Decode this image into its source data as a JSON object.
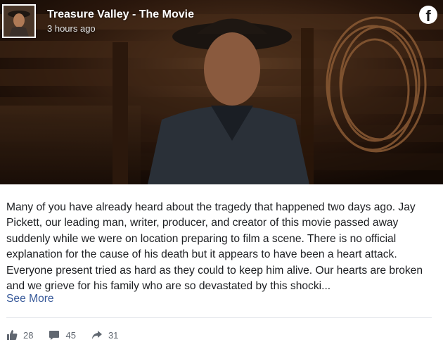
{
  "post": {
    "page_name": "Treasure Valley - The Movie",
    "time": "3 hours ago",
    "brand_icon": "facebook-icon",
    "body": "Many of you have already heard about the tragedy that happened two days ago. Jay Pickett, our leading man, writer, producer, and creator of this movie passed away suddenly while we were on location preparing to film a scene. There is no official explanation for the cause of his death but it appears to have been a heart attack. Everyone present tried as hard as they could to keep him alive. Our hearts are broken and we grieve for his family who are so devastated by this shocki...",
    "see_more": "See More"
  },
  "reactions": {
    "likes": {
      "icon": "thumbs-up-icon",
      "count": "28"
    },
    "comments": {
      "icon": "comment-icon",
      "count": "45"
    },
    "shares": {
      "icon": "share-icon",
      "count": "31"
    }
  },
  "colors": {
    "link": "#365899",
    "text": "#1c1e21",
    "meta": "#606770"
  }
}
